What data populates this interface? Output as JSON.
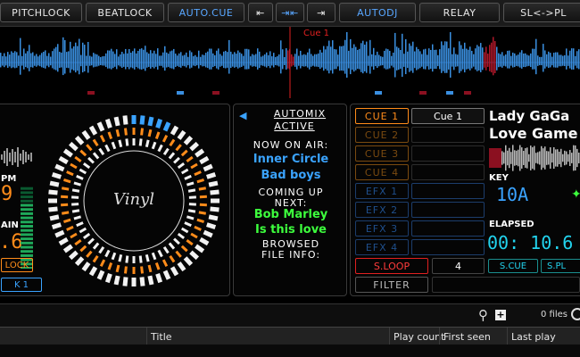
{
  "toolbar": {
    "pitchlock": "PITCHLOCK",
    "beatlock": "BEATLOCK",
    "autocue": "AUTO.CUE",
    "prev": "⇤",
    "sync": "⇥⇤",
    "next": "⇥",
    "autodj": "AUTODJ",
    "relay": "RELAY",
    "swap": "SL<->PL"
  },
  "waveform": {
    "cue_label": "Cue 1"
  },
  "left_deck": {
    "bpm_label": "PM",
    "bpm_value": "9",
    "gain_label": "AIN",
    "gain_value": ".6",
    "lock_label": "LOCK",
    "cue_label": "K 1"
  },
  "turntable": {
    "label": "Vinyl"
  },
  "automix": {
    "title_line1": "AUTOMIX",
    "title_line2": "ACTIVE",
    "now_on_air": "NOW ON AIR:",
    "current_artist": "Inner Circle",
    "current_title": "Bad boys",
    "coming_up_1": "COMING UP",
    "coming_up_2": "NEXT:",
    "next_artist": "Bob Marley",
    "next_title": "Is this love",
    "browsed_1": "BROWSED",
    "browsed_2": "FILE INFO:"
  },
  "cues": [
    {
      "label": "CUE 1",
      "value": "Cue 1",
      "active": true
    },
    {
      "label": "CUE 2",
      "value": "",
      "active": false
    },
    {
      "label": "CUE 3",
      "value": "",
      "active": false
    },
    {
      "label": "CUE 4",
      "value": "",
      "active": false
    }
  ],
  "efx": [
    {
      "label": "EFX 1",
      "value": ""
    },
    {
      "label": "EFX 2",
      "value": ""
    },
    {
      "label": "EFX 3",
      "value": ""
    },
    {
      "label": "EFX 4",
      "value": ""
    }
  ],
  "loop": {
    "label": "S.LOOP",
    "value": "4"
  },
  "filter": {
    "label": "FILTER"
  },
  "right_deck": {
    "artist": "Lady GaGa",
    "title": "Love Game",
    "key_label": "KEY",
    "key_value": "10A",
    "elapsed_label": "ELAPSED",
    "elapsed_value": "00: 10.6",
    "scue_label": "S.CUE",
    "splay_label": "S.PL"
  },
  "browser": {
    "file_count": "0 files",
    "columns": [
      "Title",
      "Play count",
      "First seen",
      "Last play"
    ]
  },
  "colors": {
    "accent_blue": "#3aa3ff",
    "accent_orange": "#ff8c1a",
    "accent_green": "#3dff3d",
    "accent_red": "#e02020",
    "accent_cyan": "#22d3ee"
  }
}
